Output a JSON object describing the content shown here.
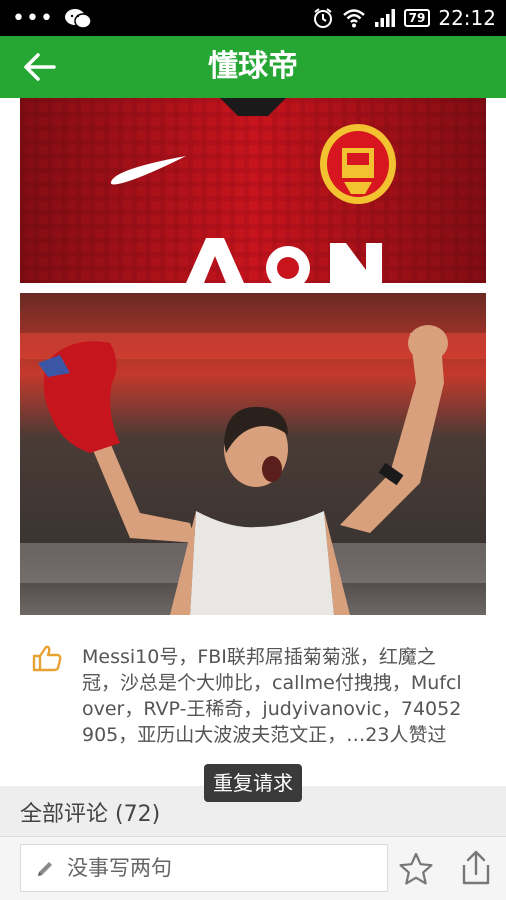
{
  "status_bar": {
    "dots": "•••",
    "battery": "79",
    "time": "22:12"
  },
  "header": {
    "title": "懂球帝"
  },
  "likes": {
    "text": "Messi10号，FBI联邦屌插菊菊涨，红魔之冠，沙总是个大帅比，callme付拽拽，Mufclover，RVP-王稀奇，judyivanovic，74052905，亚历山大波波夫范文正，…23人赞过"
  },
  "toast": {
    "text": "重复请求"
  },
  "comments": {
    "label": "全部评论 (72)"
  },
  "bottom_bar": {
    "input_placeholder": "没事写两句"
  },
  "icons": {
    "back": "arrow-left-icon",
    "like": "thumbs-up-icon",
    "pencil": "pencil-icon",
    "favorite": "star-icon",
    "share": "share-icon"
  },
  "colors": {
    "app_bar": "#26a633",
    "like_icon": "#e8a233",
    "shirt_red": "#c8141d",
    "badge_gold": "#f2c230"
  }
}
